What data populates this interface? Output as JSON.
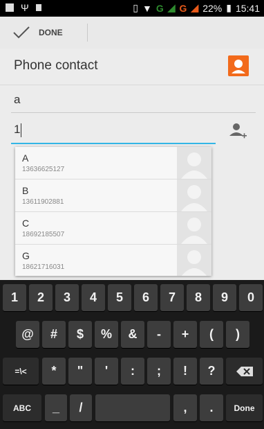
{
  "status": {
    "battery": "22%",
    "time": "15:41",
    "network": "G"
  },
  "actionbar": {
    "done_label": "DONE"
  },
  "account": {
    "title": "Phone contact"
  },
  "fields": {
    "name_value": "a",
    "phone_value": "1"
  },
  "suggestions": [
    {
      "name": "A",
      "phone": "13636625127"
    },
    {
      "name": "B",
      "phone": "13611902881"
    },
    {
      "name": "C",
      "phone": "18692185507"
    },
    {
      "name": "G",
      "phone": "18621716031"
    }
  ],
  "keyboard": {
    "row1": [
      "1",
      "2",
      "3",
      "4",
      "5",
      "6",
      "7",
      "8",
      "9",
      "0"
    ],
    "row2": [
      "@",
      "#",
      "$",
      "%",
      "&",
      "-",
      "+",
      "(",
      ")"
    ],
    "row3": [
      "=\\<",
      "*",
      "\"",
      "'",
      ":",
      ";",
      "!",
      "?"
    ],
    "row4": [
      "ABC",
      "_",
      "/",
      "",
      ",",
      ".",
      "Done"
    ]
  },
  "colors": {
    "accent": "#33b5e5",
    "account_icon": "#f26a1b"
  }
}
